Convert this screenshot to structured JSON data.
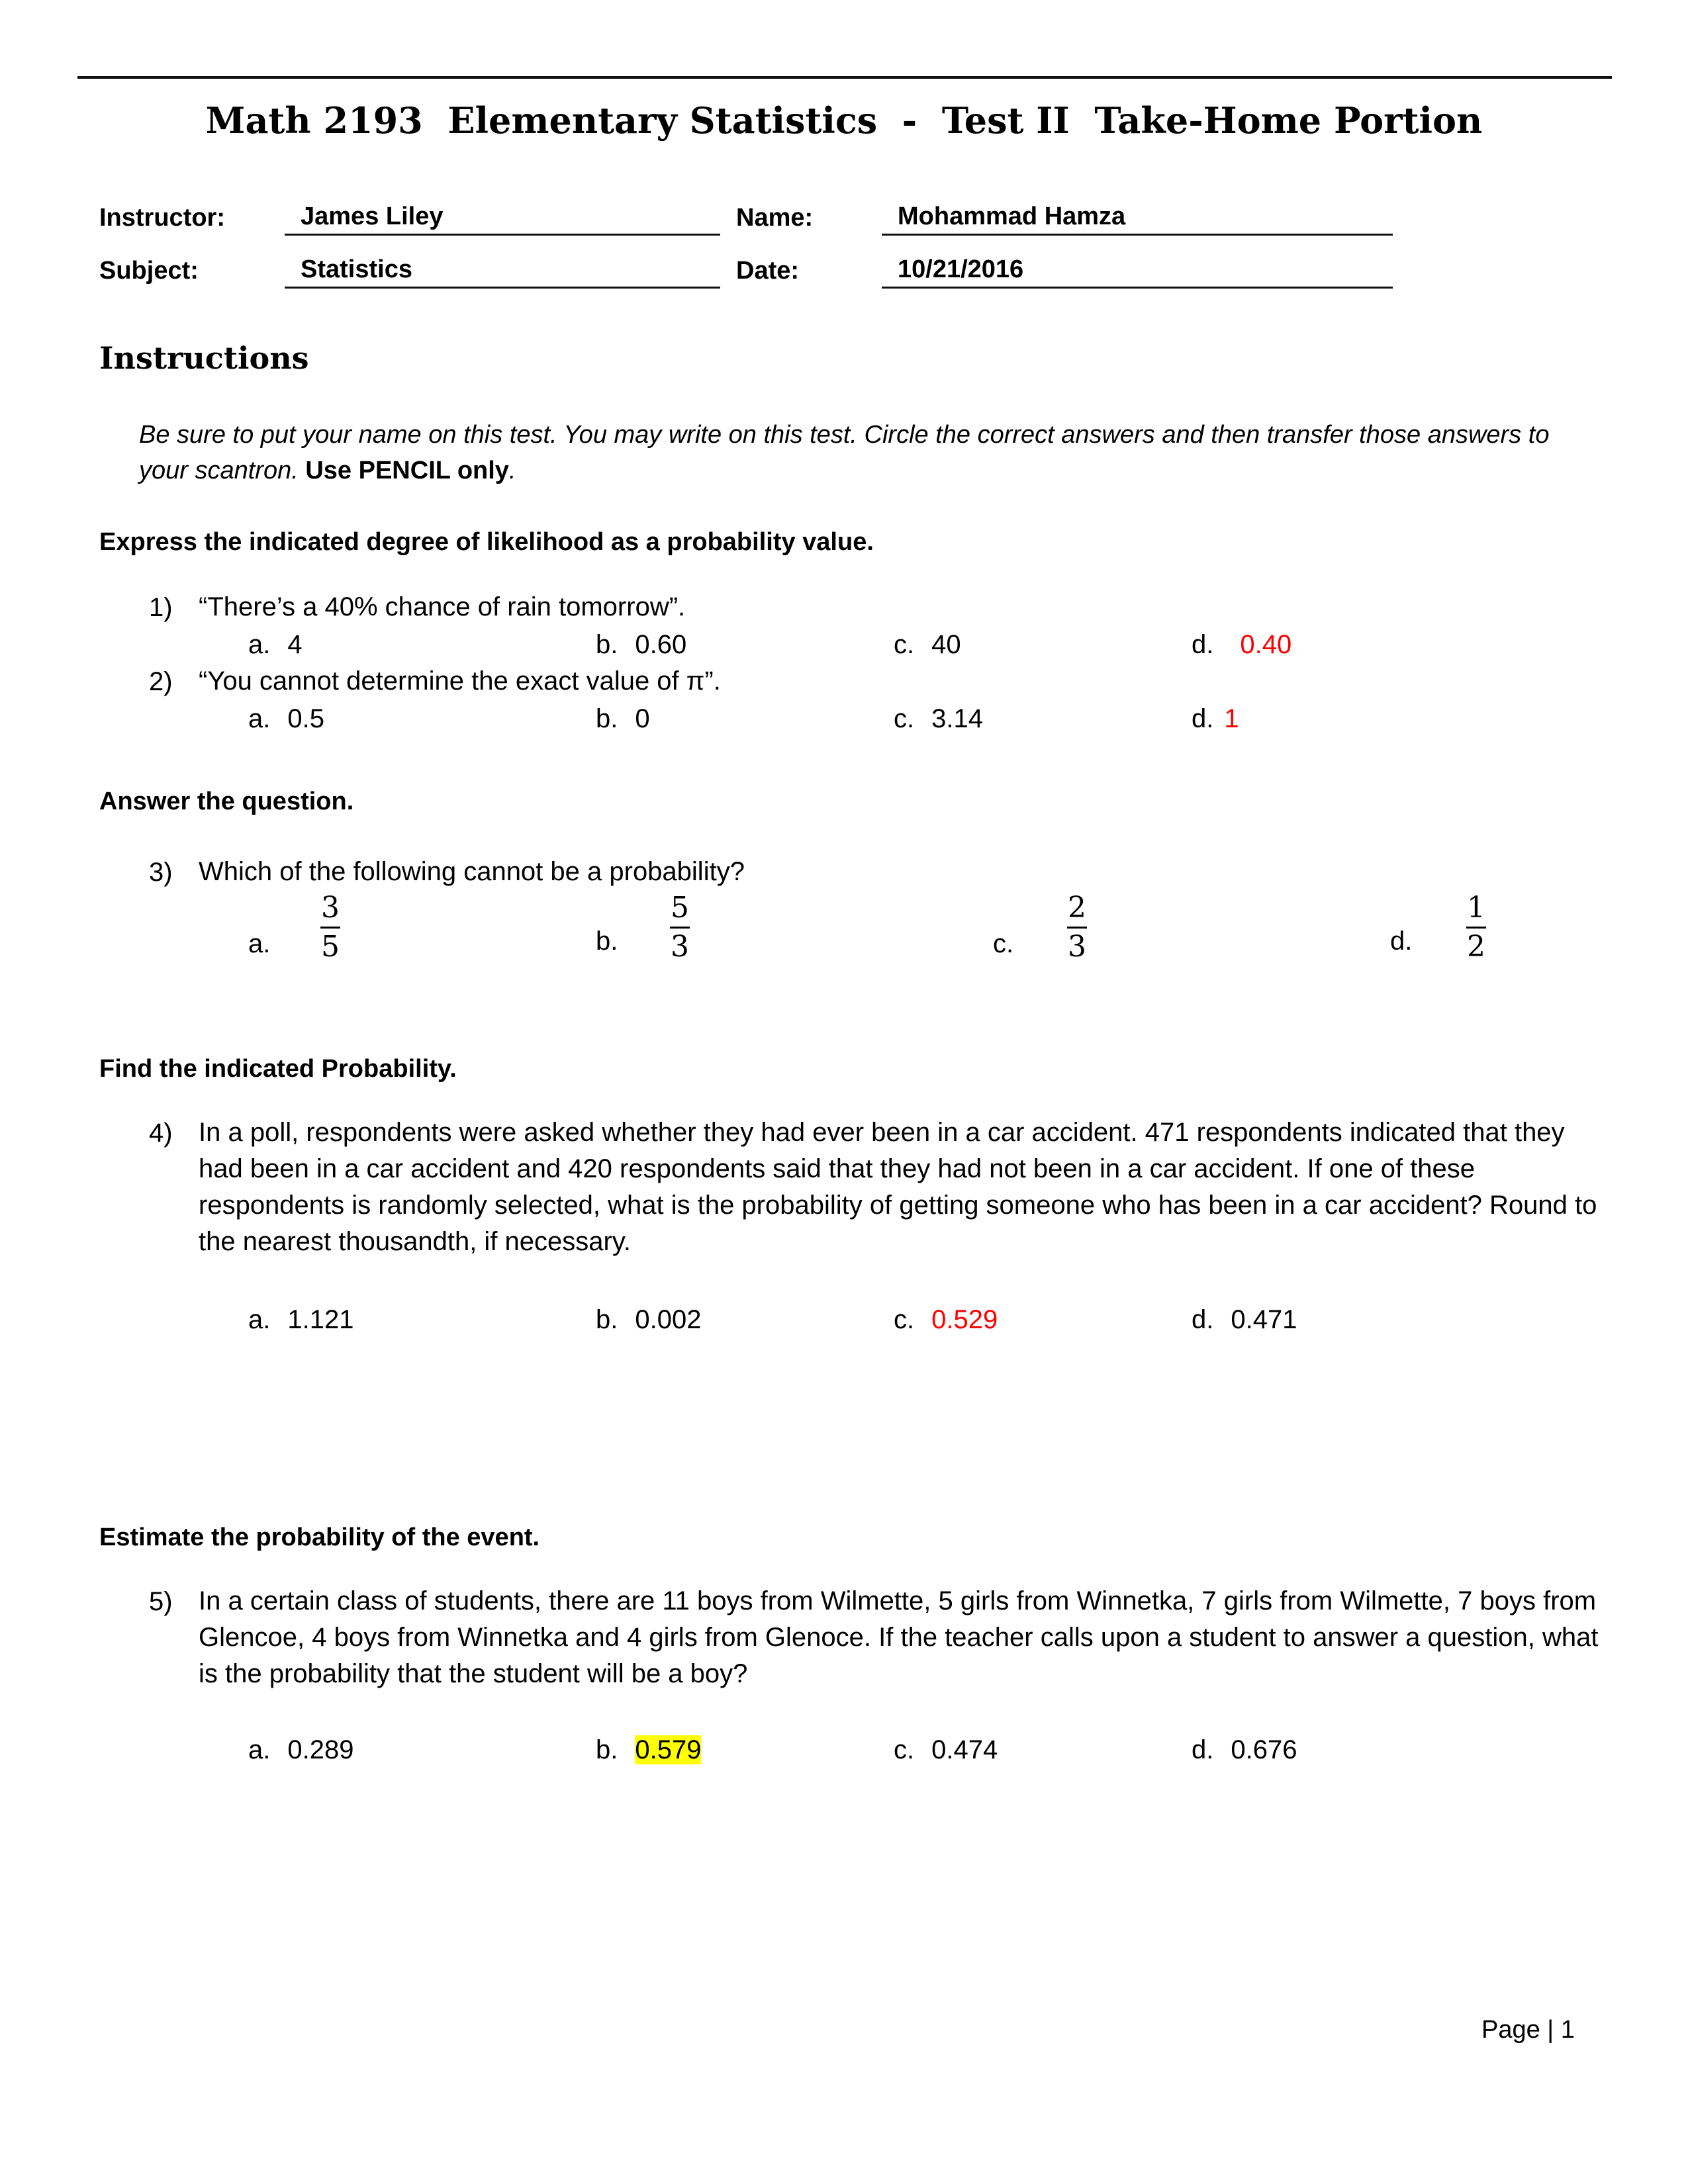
{
  "document": {
    "title": "Math 2193  Elementary Statistics  -  Test II  Take-Home Portion",
    "header_fields": {
      "instructor_label": "Instructor:",
      "instructor_value": "James Liley",
      "name_label": "Name:",
      "name_value": "Mohammad Hamza",
      "subject_label": "Subject:",
      "subject_value": "Statistics",
      "date_label": "Date:",
      "date_value": "10/21/2016"
    },
    "instructions_heading": "Instructions",
    "instructions_text": "Be sure to put your name on this test.  You may write on this test. Circle the correct answers and then transfer those answers to your scantron.  ",
    "instructions_bold": "Use PENCIL only",
    "instructions_end": ".",
    "sections": [
      {
        "heading": "Express the indicated degree of likelihood as a probability value.",
        "questions": [
          {
            "number": "1)",
            "text": "“There’s a 40% chance of rain tomorrow”.",
            "options": [
              {
                "letter": "a.",
                "value": "4"
              },
              {
                "letter": "b.",
                "value": "0.60"
              },
              {
                "letter": "c.",
                "value": "40"
              },
              {
                "letter": "d.",
                "value": "0.40",
                "marked": "red"
              }
            ]
          },
          {
            "number": "2)",
            "text": "“You cannot determine the exact value of π”.",
            "options": [
              {
                "letter": "a.",
                "value": "0.5"
              },
              {
                "letter": "b.",
                "value": "0"
              },
              {
                "letter": "c.",
                "value": "3.14"
              },
              {
                "letter": "d.",
                "value": "1",
                "marked": "red"
              }
            ]
          }
        ]
      },
      {
        "heading": "Answer the question.",
        "questions": [
          {
            "number": "3)",
            "text": "Which of the following cannot be a probability?",
            "options": [
              {
                "letter": "a.",
                "numerator": "3",
                "denominator": "5"
              },
              {
                "letter": "b.",
                "numerator": "5",
                "denominator": "3"
              },
              {
                "letter": "c.",
                "numerator": "2",
                "denominator": "3"
              },
              {
                "letter": "d.",
                "numerator": "1",
                "denominator": "2"
              }
            ]
          }
        ]
      },
      {
        "heading": "Find the indicated Probability.",
        "questions": [
          {
            "number": "4)",
            "text": "In a poll, respondents were asked whether they had ever been in a car accident.  471 respondents indicated that they had been in a car accident and 420 respondents said that they had not been in a car accident. If one of these respondents is randomly selected, what is the probability of getting someone who has been in a car accident?  Round to the nearest thousandth, if necessary.",
            "options": [
              {
                "letter": "a.",
                "value": "1.121"
              },
              {
                "letter": "b.",
                "value": "0.002"
              },
              {
                "letter": "c.",
                "value": "0.529",
                "marked": "red"
              },
              {
                "letter": "d.",
                "value": "0.471"
              }
            ]
          }
        ]
      },
      {
        "heading": "Estimate the probability of the event.",
        "questions": [
          {
            "number": "5)",
            "text": "In a certain class of students, there are  11 boys from Wilmette,  5 girls from Winnetka,  7 girls from Wilmette,  7 boys from Glencoe,  4 boys from Winnetka and  4 girls from Glenoce.  If the teacher calls upon a student to answer a question, what is the probability that the student will be a boy?",
            "options": [
              {
                "letter": "a.",
                "value": "0.289"
              },
              {
                "letter": "b.",
                "value": "0.579",
                "marked": "highlight"
              },
              {
                "letter": "c.",
                "value": "0.474"
              },
              {
                "letter": "d.",
                "value": "0.676"
              }
            ]
          }
        ]
      }
    ],
    "footer": "Page | 1",
    "colors": {
      "answer_red": "#ff0000",
      "highlight_yellow": "#ffff00"
    }
  }
}
